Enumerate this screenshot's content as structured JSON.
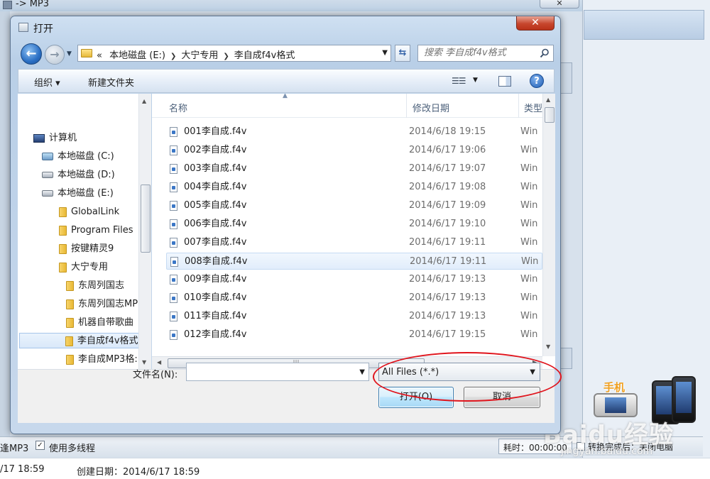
{
  "background": {
    "title": "-> MP3",
    "close_label": "✕",
    "status_left": "逢MP3",
    "multithread_checked": true,
    "multithread_label": "使用多线程",
    "elapsed_label": "耗时：00:00:00",
    "after_label": "转换完成后：关闭电脑",
    "info_left": "/17 18:59",
    "info_created": "创建日期：2014/6/17 18:59",
    "phone_promo": "手机",
    "watermark": "Baidu经验",
    "watermark_url": "jingyan.baidu.com"
  },
  "dialog": {
    "title": "打开",
    "close_label": "✕",
    "address": {
      "prefix": "«",
      "segments": [
        "本地磁盘 (E:)",
        "大宁专用",
        "李自成f4v格式"
      ]
    },
    "search_placeholder": "搜索 李自成f4v格式",
    "toolbar": {
      "organize": "组织 ▾",
      "new_folder": "新建文件夹",
      "help": "?"
    },
    "nav_tree": [
      {
        "label": "计算机",
        "icon": "computer-icon"
      },
      {
        "label": "本地磁盘 (C:)",
        "icon": "drive-icon"
      },
      {
        "label": "本地磁盘 (D:)",
        "icon": "drive-icon"
      },
      {
        "label": "本地磁盘 (E:)",
        "icon": "drive-icon"
      },
      {
        "label": "GlobalLink",
        "icon": "folder-icon"
      },
      {
        "label": "Program Files",
        "icon": "folder-icon"
      },
      {
        "label": "按键精灵9",
        "icon": "folder-icon"
      },
      {
        "label": "大宁专用",
        "icon": "folder-icon"
      },
      {
        "label": "东周列国志",
        "icon": "folder-icon"
      },
      {
        "label": "东周列国志MP",
        "icon": "folder-icon"
      },
      {
        "label": "机器自带歌曲",
        "icon": "folder-icon"
      },
      {
        "label": "李自成f4v格式",
        "icon": "folder-icon",
        "selected": true
      },
      {
        "label": "李自成MP3格:",
        "icon": "folder-icon"
      }
    ],
    "columns": {
      "name": "名称",
      "date": "修改日期",
      "type": "类型"
    },
    "files": [
      {
        "name": "001李自成.f4v",
        "date": "2014/6/18 19:15",
        "type": "Win"
      },
      {
        "name": "002李自成.f4v",
        "date": "2014/6/17 19:06",
        "type": "Win"
      },
      {
        "name": "003李自成.f4v",
        "date": "2014/6/17 19:07",
        "type": "Win"
      },
      {
        "name": "004李自成.f4v",
        "date": "2014/6/17 19:08",
        "type": "Win"
      },
      {
        "name": "005李自成.f4v",
        "date": "2014/6/17 19:09",
        "type": "Win"
      },
      {
        "name": "006李自成.f4v",
        "date": "2014/6/17 19:10",
        "type": "Win"
      },
      {
        "name": "007李自成.f4v",
        "date": "2014/6/17 19:11",
        "type": "Win"
      },
      {
        "name": "008李自成.f4v",
        "date": "2014/6/17 19:11",
        "type": "Win",
        "selected": true
      },
      {
        "name": "009李自成.f4v",
        "date": "2014/6/17 19:13",
        "type": "Win"
      },
      {
        "name": "010李自成.f4v",
        "date": "2014/6/17 19:13",
        "type": "Win"
      },
      {
        "name": "011李自成.f4v",
        "date": "2014/6/17 19:13",
        "type": "Win"
      },
      {
        "name": "012李自成.f4v",
        "date": "2014/6/17 19:15",
        "type": "Win"
      }
    ],
    "filename_label": "文件名(N):",
    "filename_value": "",
    "filter_value": "All Files (*.*)",
    "open_button": "打开(O)",
    "cancel_button": "取消"
  },
  "colors": {
    "annotation": "#e0141c",
    "accent": "#2a6fc4"
  }
}
